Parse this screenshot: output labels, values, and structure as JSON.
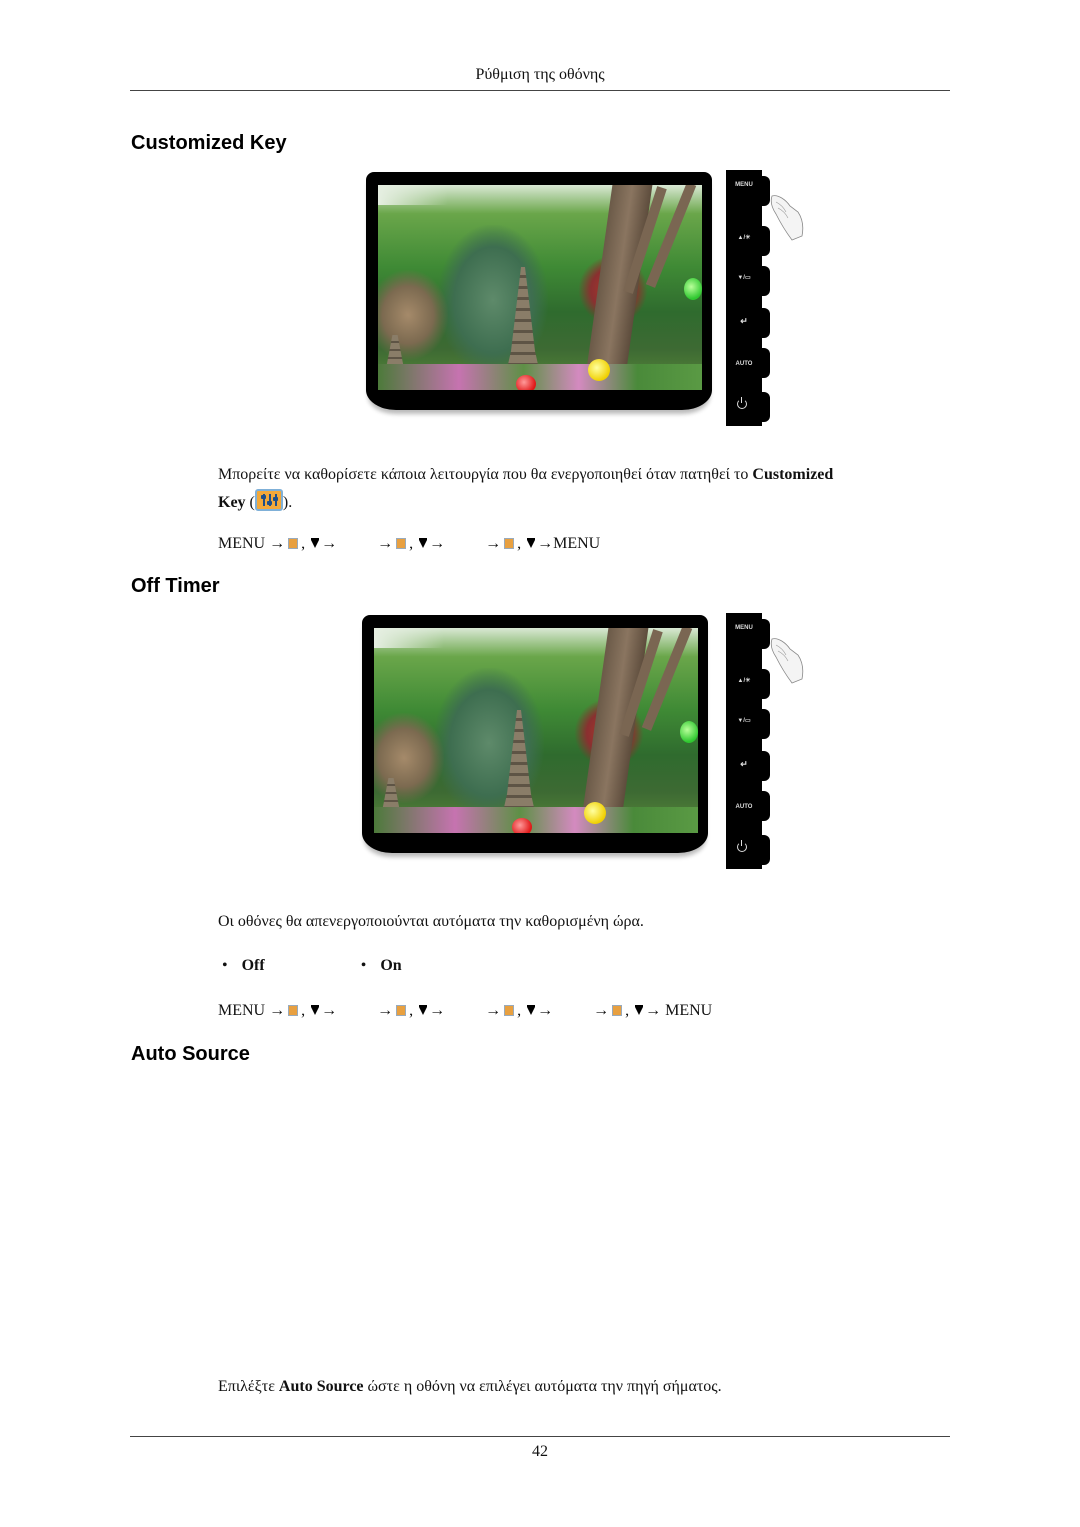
{
  "header": {
    "running_title": "Ρύθμιση της οθόνης"
  },
  "sections": [
    {
      "title": "Customized Key",
      "image": {
        "description": "monitor-with-control-buttons",
        "buttons": [
          "MENU",
          "▲/☀",
          "▼/▭",
          "↵",
          "AUTO",
          "⏻"
        ]
      },
      "paragraph": {
        "text_before": "Μπορείτε να καθορίσετε κάποια λειτουργία που θα ενεργοποιηθεί όταν πατηθεί το ",
        "bold_1": "Customized",
        "bold_2": "Key",
        "text_after_open": " (",
        "text_after_close": ")."
      },
      "menu_path": {
        "start": "MENU",
        "arrow": "→",
        "comma": ",",
        "end": "MENU"
      }
    },
    {
      "title": "Off Timer",
      "image": {
        "description": "monitor-with-control-buttons",
        "buttons": [
          "MENU",
          "▲/☀",
          "▼/▭",
          "↵",
          "AUTO",
          "⏻"
        ]
      },
      "paragraph": {
        "text": "Οι οθόνες θα απενεργοποιούνται αυτόματα την καθορισμένη ώρα."
      },
      "options": [
        "Off",
        "On"
      ],
      "bullet": "•",
      "menu_path": {
        "start": "MENU",
        "arrow": "→",
        "comma": ",",
        "end": "MENU"
      }
    },
    {
      "title": "Auto Source",
      "paragraph": {
        "text_before": "Επιλέξτε ",
        "bold": "Auto Source",
        "text_after": " ώστε η οθόνη να επιλέγει αυτόματα την πηγή σήματος."
      }
    }
  ],
  "footer": {
    "page_number": "42"
  },
  "colors": {
    "icon_orange": "#f2a83a",
    "icon_border": "#7fb0d8",
    "text": "#111111"
  }
}
